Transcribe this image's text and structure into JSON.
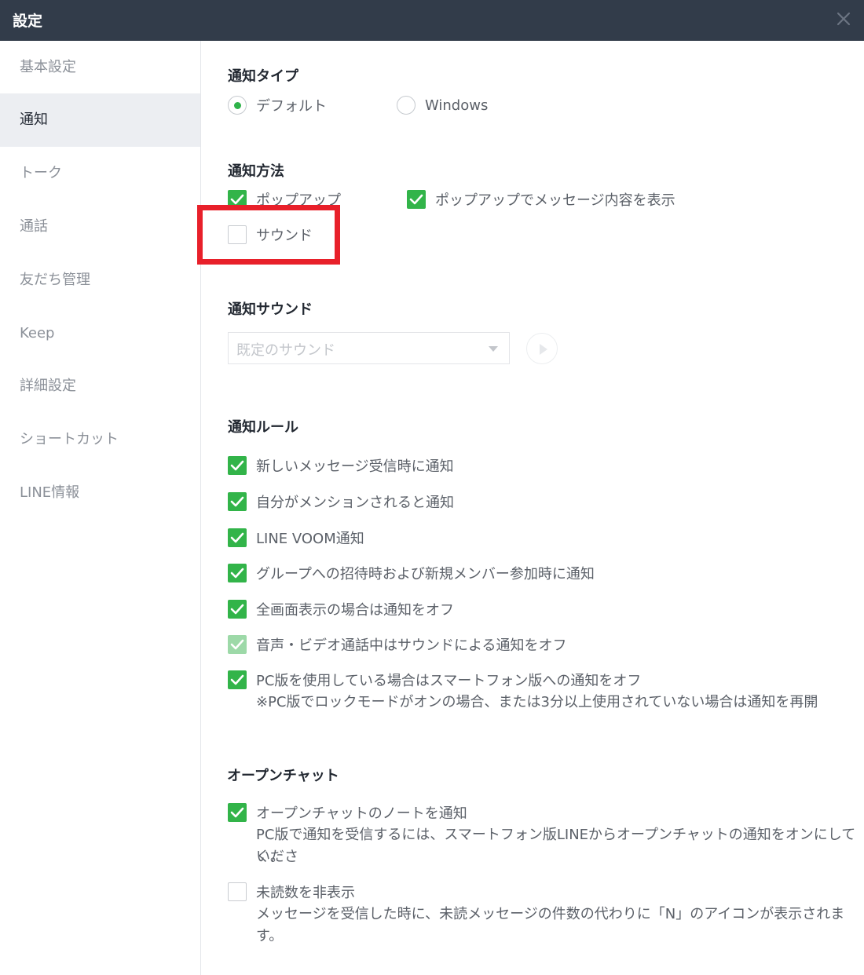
{
  "window": {
    "title": "設定"
  },
  "sidebar": {
    "items": [
      {
        "label": "基本設定"
      },
      {
        "label": "通知"
      },
      {
        "label": "トーク"
      },
      {
        "label": "通話"
      },
      {
        "label": "友だち管理"
      },
      {
        "label": "Keep"
      },
      {
        "label": "詳細設定"
      },
      {
        "label": "ショートカット"
      },
      {
        "label": "LINE情報"
      }
    ],
    "active_index": 1
  },
  "notification_type": {
    "title": "通知タイプ",
    "options": [
      {
        "label": "デフォルト",
        "selected": true
      },
      {
        "label": "Windows",
        "selected": false
      }
    ]
  },
  "notification_method": {
    "title": "通知方法",
    "popup": {
      "label": "ポップアップ",
      "checked": true
    },
    "popup_content": {
      "label": "ポップアップでメッセージ内容を表示",
      "checked": true
    },
    "sound": {
      "label": "サウンド",
      "checked": false
    }
  },
  "notification_sound": {
    "title": "通知サウンド",
    "select_value": "既定のサウンド"
  },
  "notification_rules": {
    "title": "通知ルール",
    "items": [
      {
        "label": "新しいメッセージ受信時に通知",
        "checked": true
      },
      {
        "label": "自分がメンションされると通知",
        "checked": true
      },
      {
        "label": "LINE VOOM通知",
        "checked": true
      },
      {
        "label": "グループへの招待時および新規メンバー参加時に通知",
        "checked": true
      },
      {
        "label": "全画面表示の場合は通知をオフ",
        "checked": true
      },
      {
        "label": "音声・ビデオ通話中はサウンドによる通知をオフ",
        "checked": true,
        "disabled": true
      },
      {
        "label": "PC版を使用している場合はスマートフォン版への通知をオフ",
        "checked": true,
        "note": "※PC版でロックモードがオンの場合、または3分以上使用されていない場合は通知を再開"
      }
    ]
  },
  "open_chat": {
    "title": "オープンチャット",
    "note_notify": {
      "label": "オープンチャットのノートを通知",
      "checked": true,
      "desc_line1": "PC版で通知を受信するには、スマートフォン版LINEからオープンチャットの通知をオンにしてくださ",
      "desc_line2": "い。"
    },
    "hide_unread": {
      "label": "未読数を非表示",
      "checked": false,
      "desc": "メッセージを受信した時に、未読メッセージの件数の代わりに「N」のアイコンが表示されます。"
    }
  },
  "colors": {
    "titlebar": "#323c4a",
    "check_green": "#32b449",
    "highlight_red": "#e8202a",
    "sidebar_active": "#eceef2"
  }
}
